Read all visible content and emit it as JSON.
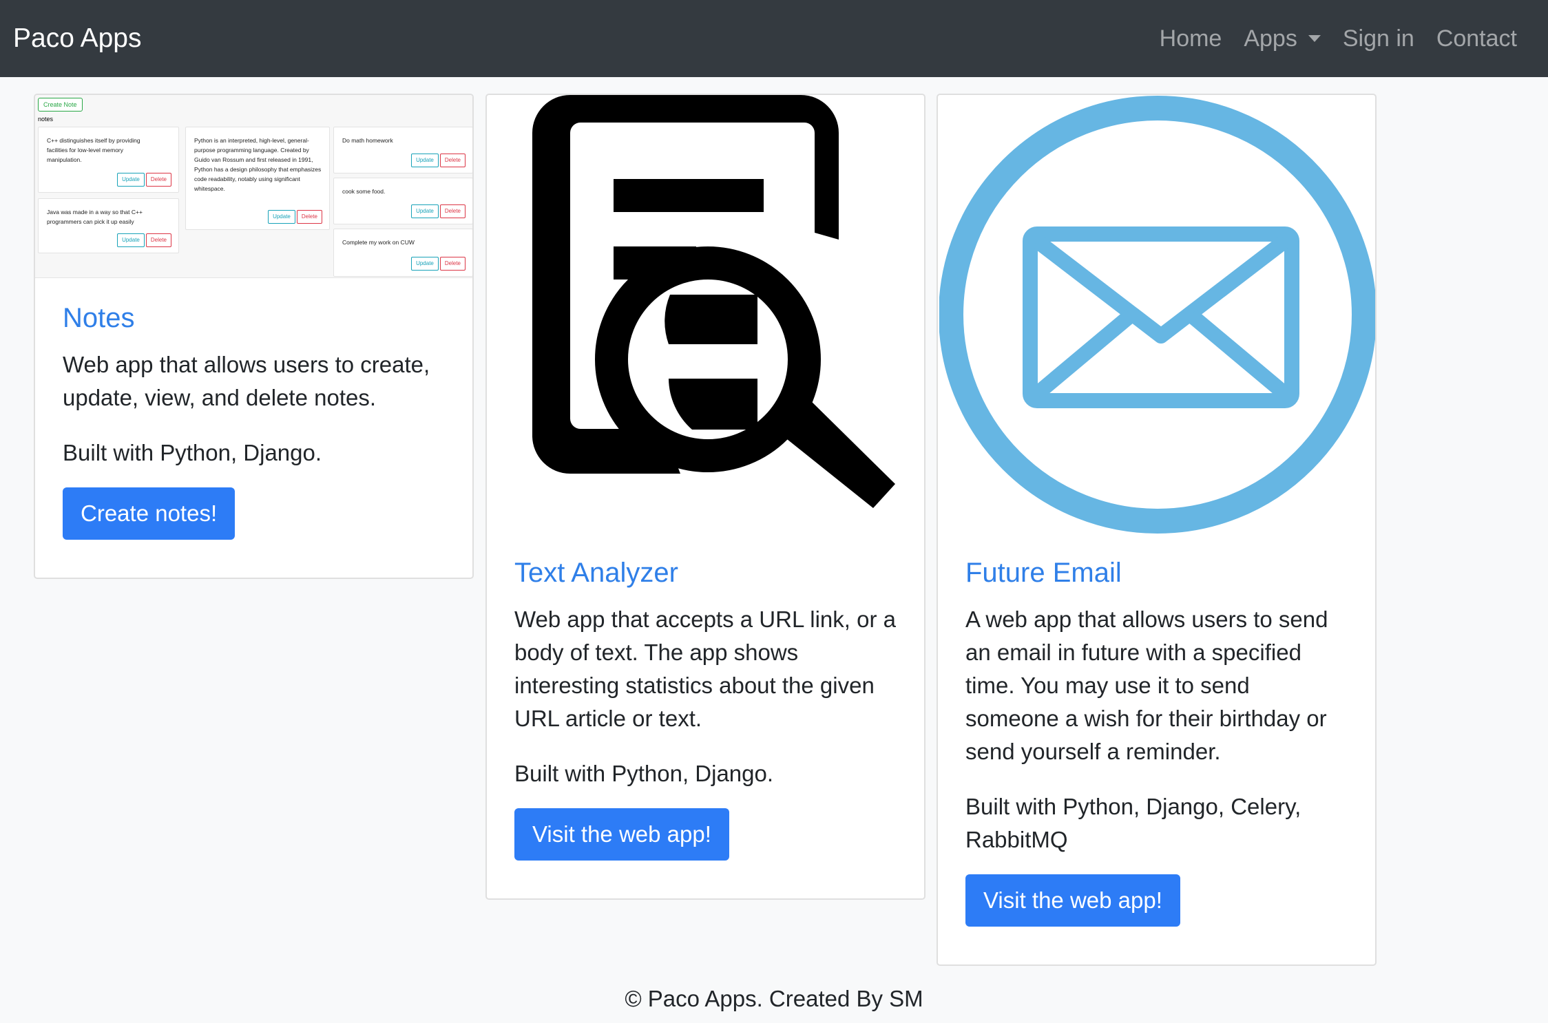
{
  "nav": {
    "brand": "Paco Apps",
    "links": {
      "home": "Home",
      "apps": "Apps",
      "signin": "Sign in",
      "contact": "Contact"
    }
  },
  "cards": {
    "notes": {
      "title": "Notes",
      "description": "Web app that allows users to create, update, view, and delete notes.",
      "built": "Built with Python, Django.",
      "button": "Create notes!",
      "preview": {
        "create_button": "Create Note",
        "heading": "notes",
        "items": [
          {
            "text": "C++ distinguishes itself by providing facilities for low-level memory manipulation.",
            "update": "Update",
            "delete": "Delete"
          },
          {
            "text": "Java was made in a way so that C++ programmers can pick it up easily",
            "update": "Update",
            "delete": "Delete"
          },
          {
            "text": "Python is an interpreted, high-level, general-purpose programming language. Created by Guido van Rossum and first released in 1991, Python has a design philosophy that emphasizes code readability, notably using significant whitespace.",
            "update": "Update",
            "delete": "Delete"
          },
          {
            "text": "Do math homework",
            "update": "Update",
            "delete": "Delete"
          },
          {
            "text": "cook some food.",
            "update": "Update",
            "delete": "Delete"
          },
          {
            "text": "Complete my work on CUW",
            "update": "Update",
            "delete": "Delete"
          }
        ]
      }
    },
    "text_analyzer": {
      "title": "Text Analyzer",
      "description": "Web app that accepts a URL link, or a body of text. The app shows interesting statistics about the given URL article or text.",
      "built": "Built with Python, Django.",
      "button": "Visit the web app!"
    },
    "future_email": {
      "title": "Future Email",
      "description": "A web app that allows users to send an email in future with a specified time. You may use it to send someone a wish for their birthday or send yourself a reminder.",
      "built": "Built with Python, Django, Celery, RabbitMQ",
      "button": "Visit the web app!"
    }
  },
  "footer": "© Paco Apps. Created By SM",
  "colors": {
    "navbar": "#343a40",
    "link_blue": "#2f7fe8",
    "button_blue": "#2d7cf6",
    "email_icon": "#66b6e3"
  },
  "icons": {
    "text_analyzer": "document-search-icon",
    "future_email": "envelope-circle-icon"
  }
}
